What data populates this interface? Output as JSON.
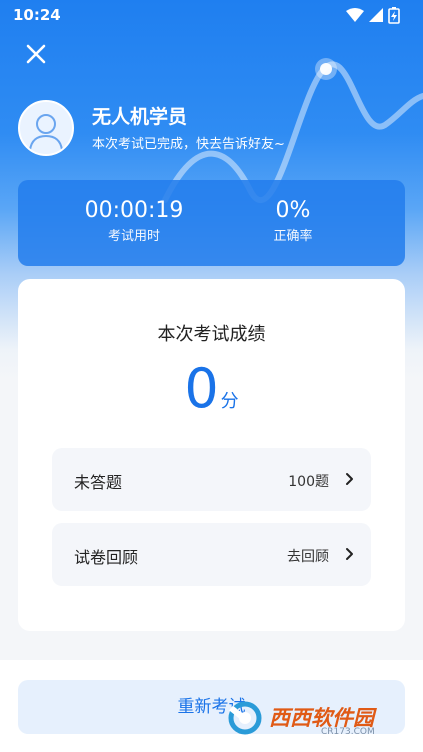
{
  "status_bar": {
    "time": "10:24"
  },
  "user": {
    "name": "无人机学员",
    "subtitle": "本次考试已完成，快去告诉好友~"
  },
  "stats": {
    "time_value": "00:00:19",
    "time_label": "考试用时",
    "accuracy_value": "0%",
    "accuracy_label": "正确率"
  },
  "score": {
    "title": "本次考试成绩",
    "value": "0",
    "unit": "分"
  },
  "rows": [
    {
      "label": "未答题",
      "value": "100题"
    },
    {
      "label": "试卷回顾",
      "value": "去回顾"
    }
  ],
  "retry_label": "重新考试",
  "watermark": {
    "text": "西西软件园",
    "domain": "CR173.COM"
  },
  "colors": {
    "primary": "#1a73e8",
    "hero": "#2f8cf3",
    "button_bg": "#e6f0fd"
  }
}
